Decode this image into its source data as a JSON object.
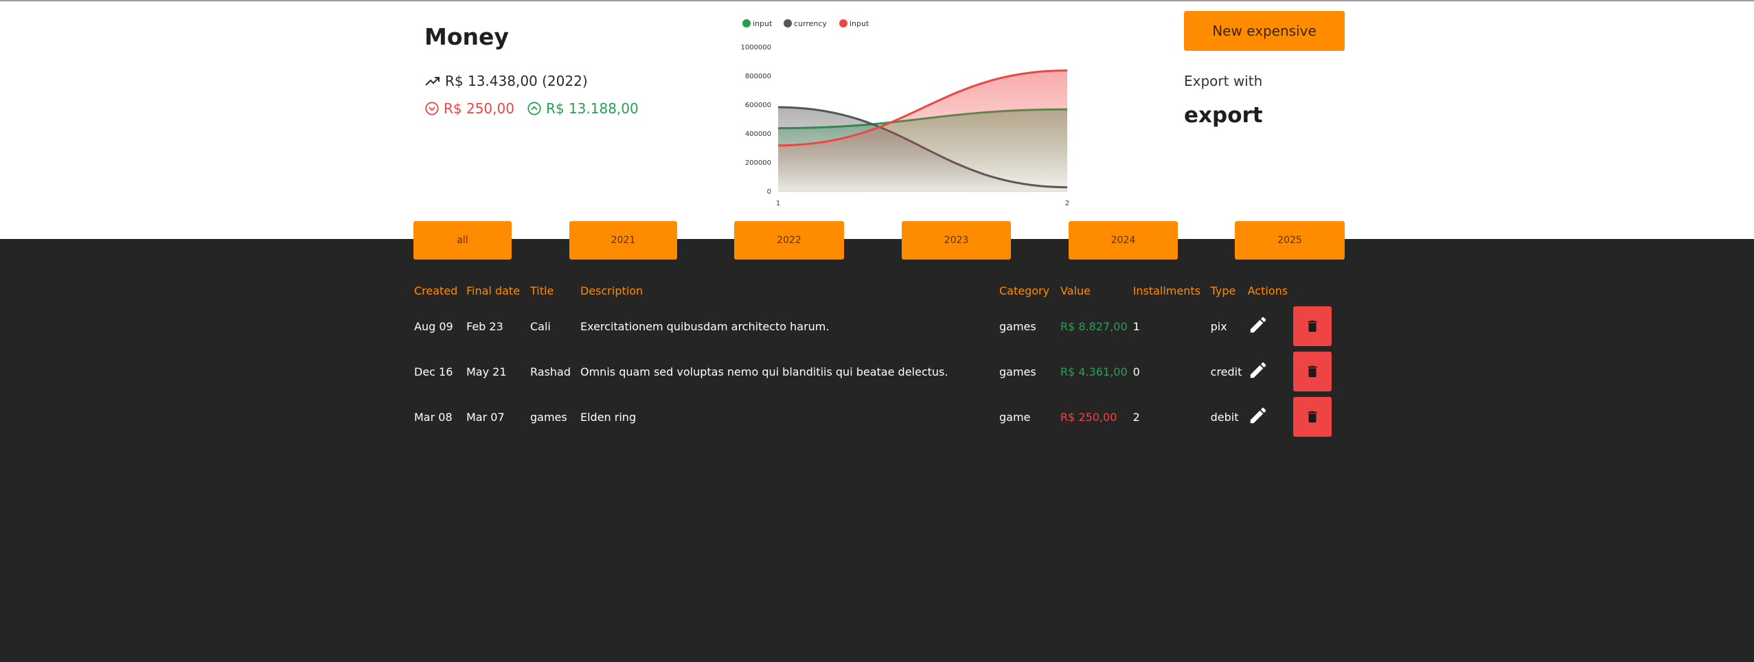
{
  "header": {
    "title": "Money",
    "total": "R$ 13.438,00 (2022)",
    "negative_total": "R$ 250,00",
    "positive_total": "R$ 13.188,00",
    "new_button_label": "New expensive",
    "export_label": "Export with",
    "export_title": "export"
  },
  "years": [
    "all",
    "2021",
    "2022",
    "2023",
    "2024",
    "2025"
  ],
  "table": {
    "headers": [
      "Created",
      "Final date",
      "Title",
      "Description",
      "Category",
      "Value",
      "Installments",
      "Type",
      "Actions"
    ],
    "rows": [
      {
        "created": "Aug 09",
        "final": "Feb 23",
        "title": "Cali",
        "description": "Exercitationem quibusdam architecto harum.",
        "category": "games",
        "value": "R$ 8.827,00",
        "installments": "1",
        "type": "pix",
        "positive": true
      },
      {
        "created": "Dec 16",
        "final": "May 21",
        "title": "Rashad",
        "description": "Omnis quam sed voluptas nemo qui blanditiis qui beatae delectus.",
        "category": "games",
        "value": "R$ 4.361,00",
        "installments": "0",
        "type": "credit",
        "positive": true
      },
      {
        "created": "Mar 08",
        "final": "Mar 07",
        "title": "games",
        "description": "Elden ring",
        "category": "game",
        "value": "R$ 250,00",
        "installments": "2",
        "type": "debit",
        "positive": false
      }
    ]
  },
  "chart_data": {
    "type": "area",
    "x": [
      1,
      2
    ],
    "xlim": [
      1,
      2
    ],
    "ylim": [
      0,
      1000000
    ],
    "yticks": [
      0,
      200000,
      400000,
      600000,
      800000,
      1000000
    ],
    "legend_position": "top",
    "series": [
      {
        "name": "input",
        "color": "#22a050",
        "values": [
          440000,
          570000
        ]
      },
      {
        "name": "currency",
        "color": "#555555",
        "values": [
          585000,
          30000
        ]
      },
      {
        "name": "input",
        "color": "#ef4444",
        "values": [
          320000,
          840000
        ]
      }
    ]
  },
  "colors": {
    "accent": "#ff8c00",
    "danger": "#ef4444",
    "success": "#27a052",
    "dark_bg": "#252525"
  }
}
